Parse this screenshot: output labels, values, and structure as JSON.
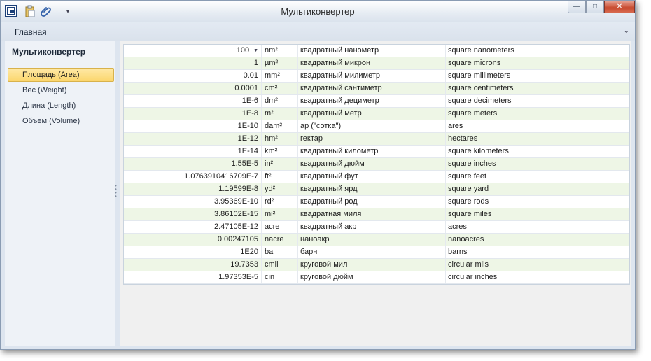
{
  "window": {
    "title": "Мультиконвертер",
    "ribbon_tab": "Главная"
  },
  "sidebar": {
    "title": "Мультиконвертер",
    "items": [
      {
        "label": "Площадь (Area)"
      },
      {
        "label": "Вес (Weight)"
      },
      {
        "label": "Длина (Length)"
      },
      {
        "label": "Объем (Volume)"
      }
    ]
  },
  "grid": {
    "rows": [
      {
        "value": "100",
        "abbr": "nm²",
        "ru": "квадратный нанометр",
        "en": "square nanometers"
      },
      {
        "value": "1",
        "abbr": "µm²",
        "ru": "квадратный микрон",
        "en": "square microns"
      },
      {
        "value": "0.01",
        "abbr": "mm²",
        "ru": "квадратный милиметр",
        "en": "square millimeters"
      },
      {
        "value": "0.0001",
        "abbr": "cm²",
        "ru": "квадратный сантиметр",
        "en": "square centimeters"
      },
      {
        "value": "1E-6",
        "abbr": "dm²",
        "ru": "квадратный дециметр",
        "en": "square decimeters"
      },
      {
        "value": "1E-8",
        "abbr": "m²",
        "ru": "квадратный метр",
        "en": "square meters"
      },
      {
        "value": "1E-10",
        "abbr": "dam²",
        "ru": "ар (\"сотка\")",
        "en": "ares"
      },
      {
        "value": "1E-12",
        "abbr": "hm²",
        "ru": "гектар",
        "en": "hectares"
      },
      {
        "value": "1E-14",
        "abbr": "km²",
        "ru": "квадратный километр",
        "en": "square kilometers"
      },
      {
        "value": "1.55E-5",
        "abbr": "in²",
        "ru": "квадратный дюйм",
        "en": "square inches"
      },
      {
        "value": "1.0763910416709E-7",
        "abbr": "ft²",
        "ru": "квадратный фут",
        "en": "square feet"
      },
      {
        "value": "1.19599E-8",
        "abbr": "yd²",
        "ru": "квадратный ярд",
        "en": "square yard"
      },
      {
        "value": "3.95369E-10",
        "abbr": "rd²",
        "ru": "квадратный род",
        "en": "square rods"
      },
      {
        "value": "3.86102E-15",
        "abbr": "mi²",
        "ru": "квадратная миля",
        "en": "square miles"
      },
      {
        "value": "2.47105E-12",
        "abbr": "acre",
        "ru": "квадратный акр",
        "en": "acres"
      },
      {
        "value": "0.00247105",
        "abbr": "nacre",
        "ru": "наноакр",
        "en": "nanoacres"
      },
      {
        "value": "1E20",
        "abbr": "ba",
        "ru": "барн",
        "en": "barns"
      },
      {
        "value": "19.7353",
        "abbr": "cmil",
        "ru": "круговой мил",
        "en": "circular mils"
      },
      {
        "value": "1.97353E-5",
        "abbr": "cin",
        "ru": "круговой дюйм",
        "en": "circular inches"
      }
    ]
  },
  "icons": {
    "app": "app-logo-icon",
    "paste": "paste-icon",
    "attach": "paperclip-icon",
    "customize": "chevron-down-icon",
    "minimize": "minimize-icon",
    "maximize": "maximize-icon",
    "close": "close-icon",
    "ribbon_collapse": "chevron-up-icon",
    "dropdown": "dropdown-arrow-icon"
  },
  "colors": {
    "active_nav": "#fbd66d",
    "alt_row": "#eef6e6",
    "close_button": "#c7492d"
  }
}
